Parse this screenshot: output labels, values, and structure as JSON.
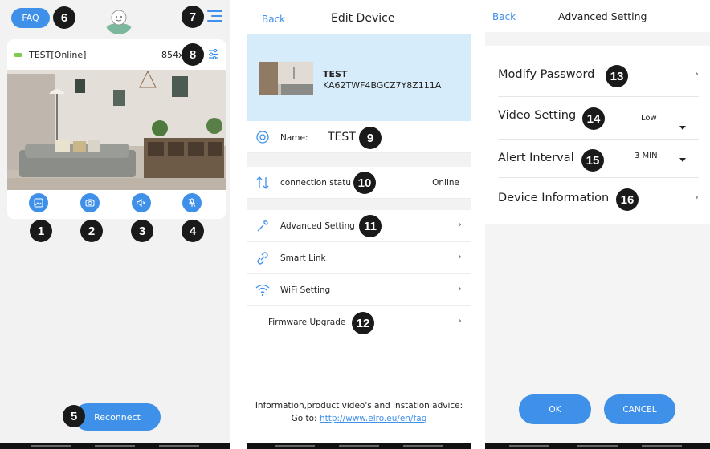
{
  "screen1": {
    "faq_label": "FAQ",
    "camera_title": "TEST[Online]",
    "camera_resolution": "854x",
    "reconnect_label": "Reconnect",
    "badges": [
      "1",
      "2",
      "3",
      "4",
      "5",
      "6",
      "7",
      "8"
    ]
  },
  "screen2": {
    "back_label": "Back",
    "title": "Edit Device",
    "device_name": "TEST",
    "device_id": "KA62TWF4BGCZ7Y8Z111A",
    "name_label": "Name:",
    "name_value": "TEST",
    "connection_label": "connection statu",
    "connection_value": "Online",
    "menu": {
      "advanced": "Advanced Setting",
      "smartlink": "Smart Link",
      "wifi": "WiFi Setting",
      "firmware": "Firmware Upgrade"
    },
    "info_text": "Information,product video's and instation advice:",
    "goto_label": "Go to:",
    "link_text": "http://www.elro.eu/en/faq",
    "badges": [
      "9",
      "10",
      "11",
      "12"
    ]
  },
  "screen3": {
    "back_label": "Back",
    "title": "Advanced Setting",
    "rows": {
      "modify_password": "Modify Password",
      "video_setting": "Video Setting",
      "video_value": "Low",
      "alert_interval": "Alert Interval",
      "alert_value": "3 MIN",
      "device_information": "Device Information"
    },
    "ok_label": "OK",
    "cancel_label": "CANCEL",
    "badges": [
      "13",
      "14",
      "15",
      "16"
    ]
  },
  "colors": {
    "accent": "#3f90e9",
    "online_dot": "#7ecb52",
    "device_block": "#d7ecfa"
  }
}
